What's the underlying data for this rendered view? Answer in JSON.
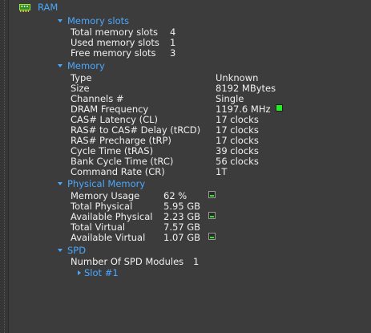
{
  "root": {
    "label": "RAM",
    "icon": "ram-icon"
  },
  "memory_slots": {
    "label": "Memory slots",
    "rows": [
      {
        "key": "Total memory slots",
        "value": "4"
      },
      {
        "key": "Used memory slots",
        "value": "1"
      },
      {
        "key": "Free memory slots",
        "value": "3"
      }
    ]
  },
  "memory": {
    "label": "Memory",
    "rows": [
      {
        "key": "Type",
        "value": "Unknown"
      },
      {
        "key": "Size",
        "value": "8192 MBytes"
      },
      {
        "key": "Channels #",
        "value": "Single"
      },
      {
        "key": "DRAM Frequency",
        "value": "1197.6 MHz"
      },
      {
        "key": "CAS# Latency (CL)",
        "value": "17 clocks"
      },
      {
        "key": "RAS# to CAS# Delay (tRCD)",
        "value": "17 clocks"
      },
      {
        "key": "RAS# Precharge (tRP)",
        "value": "17 clocks"
      },
      {
        "key": "Cycle Time (tRAS)",
        "value": "39 clocks"
      },
      {
        "key": "Bank Cycle Time (tRC)",
        "value": "56 clocks"
      },
      {
        "key": "Command Rate (CR)",
        "value": "1T"
      }
    ]
  },
  "physical_memory": {
    "label": "Physical Memory",
    "rows": [
      {
        "key": "Memory Usage",
        "value": "62 %"
      },
      {
        "key": "Total Physical",
        "value": "5.95 GB"
      },
      {
        "key": "Available Physical",
        "value": "2.23 GB"
      },
      {
        "key": "Total Virtual",
        "value": "7.57 GB"
      },
      {
        "key": "Available Virtual",
        "value": "1.07 GB"
      }
    ]
  },
  "spd": {
    "label": "SPD",
    "rows": [
      {
        "key": "Number Of SPD Modules",
        "value": "1"
      }
    ],
    "slot_label": "Slot #1"
  },
  "colors": {
    "background": "#3c3c3c",
    "accent": "#4aa8ff",
    "text": "#f0f0f0",
    "indicator_green": "#22ee22"
  }
}
